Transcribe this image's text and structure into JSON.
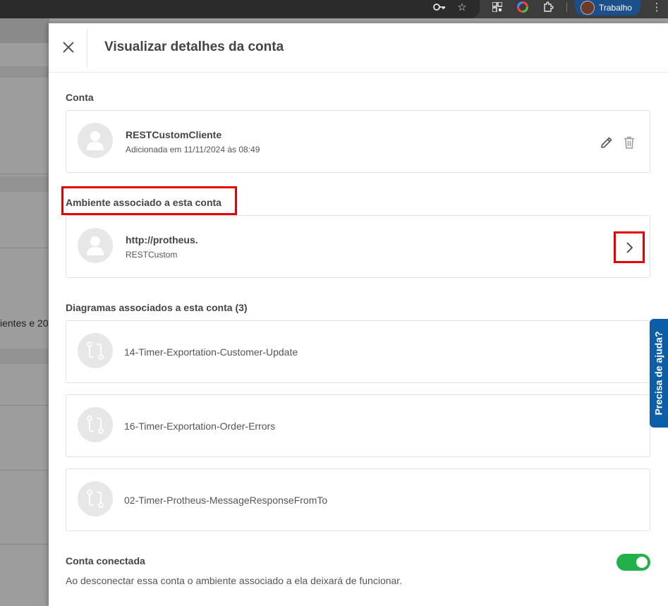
{
  "browser": {
    "profile_label": "Trabalho"
  },
  "background_page": {
    "partial_text": "ientes e 20"
  },
  "drawer": {
    "title": "Visualizar detalhes da conta",
    "account_section": {
      "title": "Conta",
      "name": "RESTCustomCliente",
      "added": "Adicionada em 11/11/2024 às 08:49"
    },
    "environment_section": {
      "title": "Ambiente associado a esta conta",
      "url": "http://protheus.",
      "account": "RESTCustom"
    },
    "diagrams_section": {
      "title": "Diagramas associados a esta conta (3)",
      "items": [
        {
          "name": "14-Timer-Exportation-Customer-Update"
        },
        {
          "name": "16-Timer-Exportation-Order-Errors"
        },
        {
          "name": "02-Timer-Protheus-MessageResponseFromTo"
        }
      ]
    },
    "connected_section": {
      "title": "Conta conectada",
      "description": "Ao desconectar essa conta o ambiente associado a ela deixará de funcionar.",
      "connected": true
    }
  },
  "help_tab": {
    "label": "Precisa de ajuda?"
  },
  "colors": {
    "toggle_on": "#22b04b",
    "highlight": "#e30000",
    "help_tab": "#0c5ea8"
  }
}
